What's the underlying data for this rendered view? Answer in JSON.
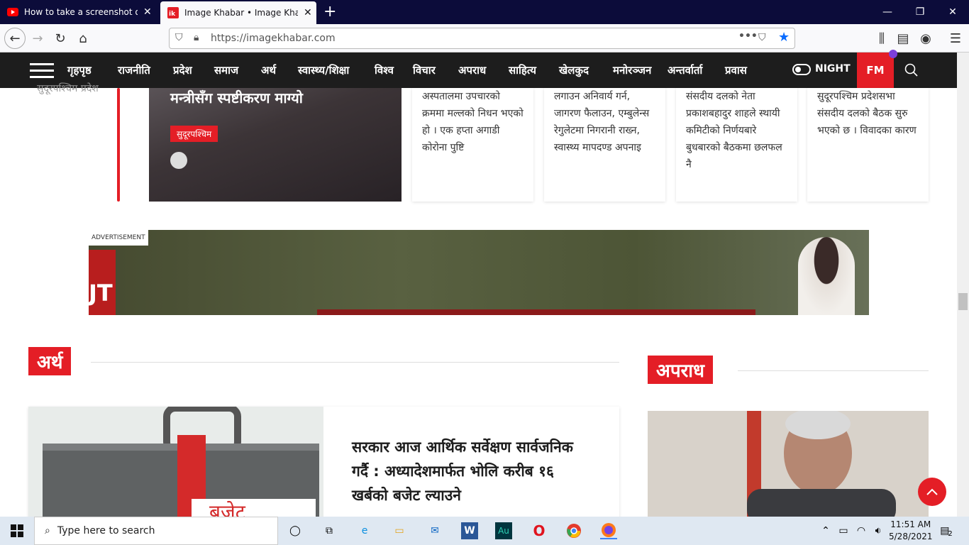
{
  "browser": {
    "tabs": [
      {
        "title": "How to take a screenshot on a P",
        "active": false
      },
      {
        "title": "Image Khabar • Image Khabar",
        "active": true
      }
    ],
    "url": "https://imagekhabar.com"
  },
  "site": {
    "nav": [
      "गृहपृष्ठ",
      "राजनीति",
      "प्रदेश",
      "समाज",
      "अर्थ",
      "स्वास्थ्य/शिक्षा",
      "विश्व",
      "विचार",
      "अपराध",
      "साहित्य",
      "खेलकुद",
      "मनोरञ्जन",
      "अन्तर्वार्ता",
      "प्रवास"
    ],
    "night_label": "NIGHT",
    "fm_label": "FM",
    "accent": "#e41e26"
  },
  "hero": {
    "left_text": "सुदूरपश्चिम प्रदेश",
    "headline": "मन्त्रीसँग स्पष्टीकरण माग्यो",
    "category": "सुदूरपश्चिम"
  },
  "cards": [
    {
      "text": "अस्पतालमा उपचारको क्रममा मल्लको निधन भएको हो । एक हप्ता अगाडी कोरोना पुष्टि"
    },
    {
      "text": "लगाउन अनिवार्य गर्न, जागरण फैलाउन, एम्बुलेन्स रेगुलेटमा निगरानी राख्न, स्वास्थ्य मापदण्ड अपनाइ"
    },
    {
      "text": "संसदीय दलको नेता प्रकाशबहादुर शाहले स्थायी कमिटीको निर्णयबारे बुधबारको बैठकमा छलफल नै"
    },
    {
      "text": "सुदूरपश्चिम प्रदेशसभा संसदीय दलको बैठक सुरु भएको छ । विवादका कारण"
    }
  ],
  "ad": {
    "label": "ADVERTISEMENT"
  },
  "sections": {
    "artha": {
      "title": "अर्थ",
      "article_title": "सरकार आज आर्थिक सर्वेक्षण सार्वजनिक गर्दै : अध्यादेशमार्फत भोलि करीब १६ खर्बको बजेट ल्याउने",
      "image_text": "बजेट"
    },
    "aparadh": {
      "title": "अपराध"
    }
  },
  "taskbar": {
    "search_placeholder": "Type here to search",
    "time": "11:51 AM",
    "date": "5/28/2021",
    "notification_count": "2"
  }
}
